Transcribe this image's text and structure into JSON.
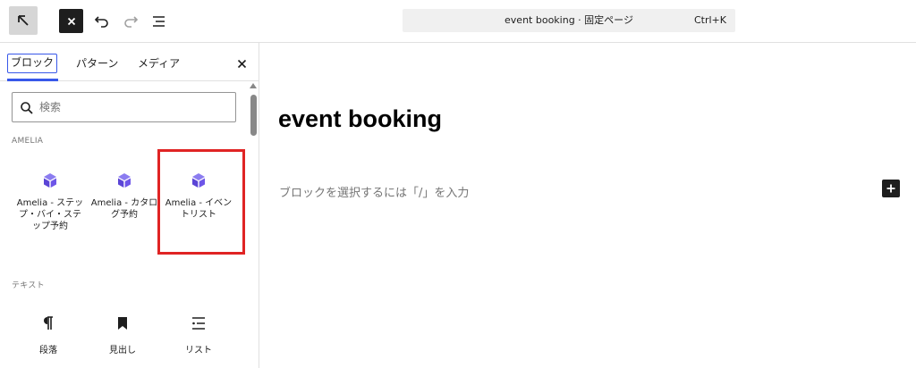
{
  "toolbar": {
    "title": "event booking · 固定ページ",
    "shortcut": "Ctrl+K"
  },
  "inserter": {
    "tabs": [
      {
        "label": "ブロック",
        "active": true
      },
      {
        "label": "パターン",
        "active": false
      },
      {
        "label": "メディア",
        "active": false
      }
    ],
    "search": {
      "placeholder": "検索",
      "value": ""
    },
    "categories": [
      {
        "title": "AMELIA",
        "blocks": [
          {
            "label": "Amelia - ステップ・バイ・ステップ予約",
            "icon": "amelia-icon"
          },
          {
            "label": "Amelia - カタログ予約",
            "icon": "amelia-icon"
          },
          {
            "label": "Amelia - イベントリスト",
            "icon": "amelia-icon",
            "highlighted": true
          }
        ]
      },
      {
        "title": "テキスト",
        "blocks": [
          {
            "label": "段落",
            "icon": "paragraph-icon"
          },
          {
            "label": "見出し",
            "icon": "heading-icon"
          },
          {
            "label": "リスト",
            "icon": "list-icon"
          }
        ]
      }
    ]
  },
  "editor": {
    "page_title": "event booking",
    "placeholder": "ブロックを選択するには「/」を入力"
  },
  "colors": {
    "accent": "#3858e9",
    "amelia_purple": "#6d55e8",
    "highlight_red": "#e02424",
    "dark": "#1e1e1e"
  }
}
